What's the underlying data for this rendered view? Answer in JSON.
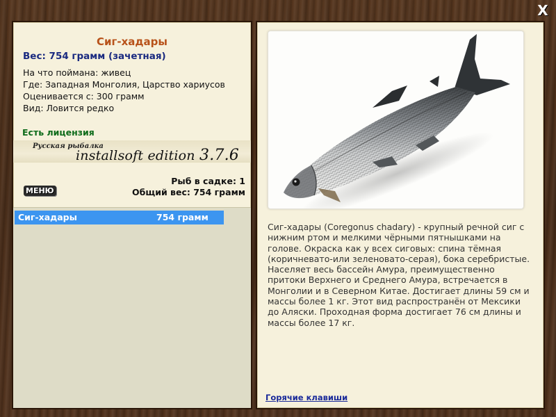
{
  "window": {
    "close_label": "X"
  },
  "fish": {
    "name": "Сиг-хадары",
    "weight_line": "Вес: 754 грамм (зачетная)",
    "info": [
      "На что поймана: живец",
      "Где: Западная Монголия, Царство хариусов",
      "Оценивается с: 300 грамм",
      "Вид: Ловится редко"
    ],
    "license": "Есть лицензия",
    "description": "Сиг-хадары (Coregonus chadary) - крупный речной сиг с нижним ртом и мелкими чёрными пятнышками на голове. Окраска как у всех сиговых: спина тёмная (коричневато-или зеленовато-серая), бока серебристые. Населяет весь бассейн Амура, преимущественно притоки Верхнего и Среднего Амура, встречается в Монголии и в Северном Китае. Достигает длины 59 см и массы более 1 кг. Этот вид распространён от Мексики до Аляски. Проходная форма достигает 76 см длины и массы более 17 кг."
  },
  "banner": {
    "small": "Русская рыбалка",
    "big": "installsoft edition",
    "version": "3.7.6"
  },
  "keepnet": {
    "count_line": "Рыб в садке: 1",
    "total_line": "Общий вес: 754 грамм"
  },
  "menu_label": "МЕНЮ",
  "catch_list": [
    {
      "name": "Сиг-хадары",
      "weight": "754 грамм"
    }
  ],
  "hotkeys_label": "Горячие клавиши",
  "icons": {
    "close": "close-icon",
    "fish": "fish-photo"
  },
  "colors": {
    "title": "#b8521a",
    "weight": "#1a2a80",
    "license": "#0d6b1a",
    "selection": "#3c95f0",
    "link": "#1a2a9a"
  }
}
